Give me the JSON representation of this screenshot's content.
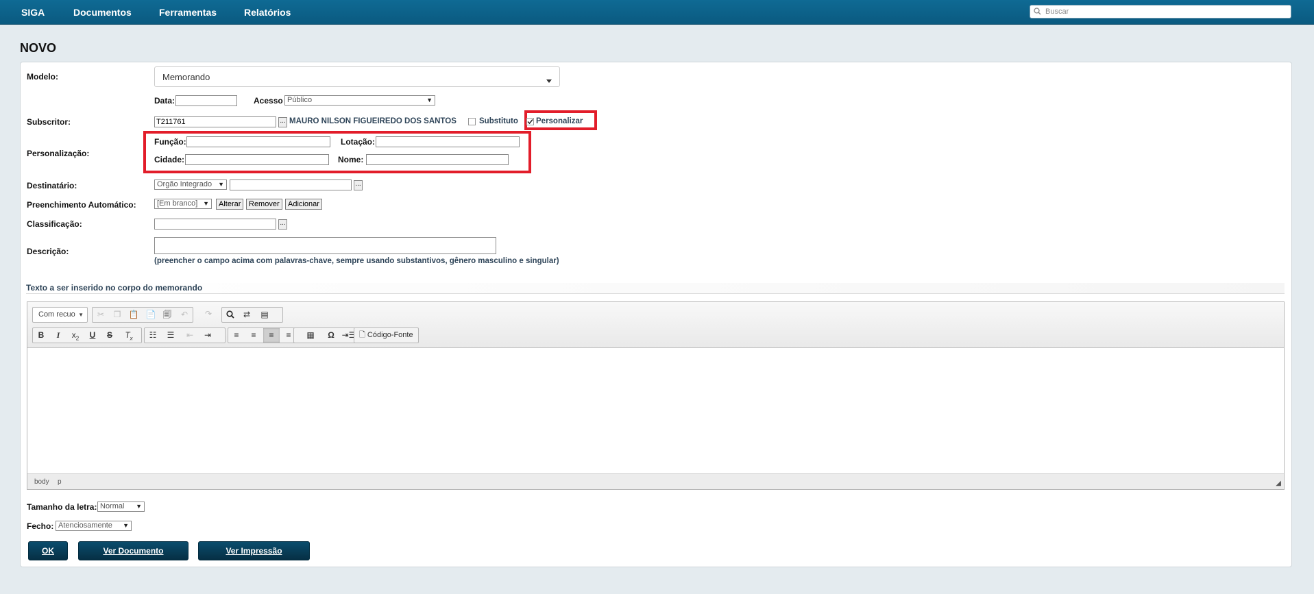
{
  "nav": {
    "items": [
      "SIGA",
      "Documentos",
      "Ferramentas",
      "Relatórios"
    ],
    "search_placeholder": "Buscar"
  },
  "page_title": "NOVO",
  "form": {
    "modelo_label": "Modelo:",
    "modelo_value": "Memorando",
    "data_label": "Data:",
    "data_value": "",
    "acesso_label": "Acesso",
    "acesso_value": "Público",
    "subscritor_label": "Subscritor:",
    "subscritor_code": "T211761",
    "subscritor_name": "MAURO NILSON FIGUEIREDO DOS SANTOS",
    "substituto_label": "Substituto",
    "substituto_checked": false,
    "personalizar_label": "Personalizar",
    "personalizar_checked": true,
    "personalizacao_label": "Personalização:",
    "funcao_label": "Função:",
    "lotacao_label": "Lotação:",
    "cidade_label": "Cidade:",
    "nome_label": "Nome:",
    "destinatario_label": "Destinatário:",
    "destinatario_type": "Orgão Integrado",
    "preenchimento_label": "Preenchimento Automático:",
    "preenchimento_value": "[Em branco]",
    "alterar_label": "Alterar",
    "remover_label": "Remover",
    "adicionar_label": "Adicionar",
    "classificacao_label": "Classificação:",
    "descricao_label": "Descrição:",
    "descricao_hint": "(preencher o campo acima com palavras-chave, sempre usando substantivos, gênero masculino e singular)",
    "ellipsis": "..."
  },
  "section_title": "Texto a ser inserido no corpo do memorando",
  "editor": {
    "format_combo": "Com recuo",
    "source_label": "Código-Fonte",
    "path": [
      "body",
      "p"
    ]
  },
  "bottom": {
    "tamanho_label": "Tamanho da letra:",
    "tamanho_value": "Normal",
    "fecho_label": "Fecho:",
    "fecho_value": "Atenciosamente",
    "ok_label": "OK",
    "ver_documento_label": "Ver Documento",
    "ver_impressao_label": "Ver Impressão"
  },
  "colors": {
    "navbar": "#0f6a94",
    "highlight": "#e21d2a",
    "button": "#0b4d6d"
  }
}
